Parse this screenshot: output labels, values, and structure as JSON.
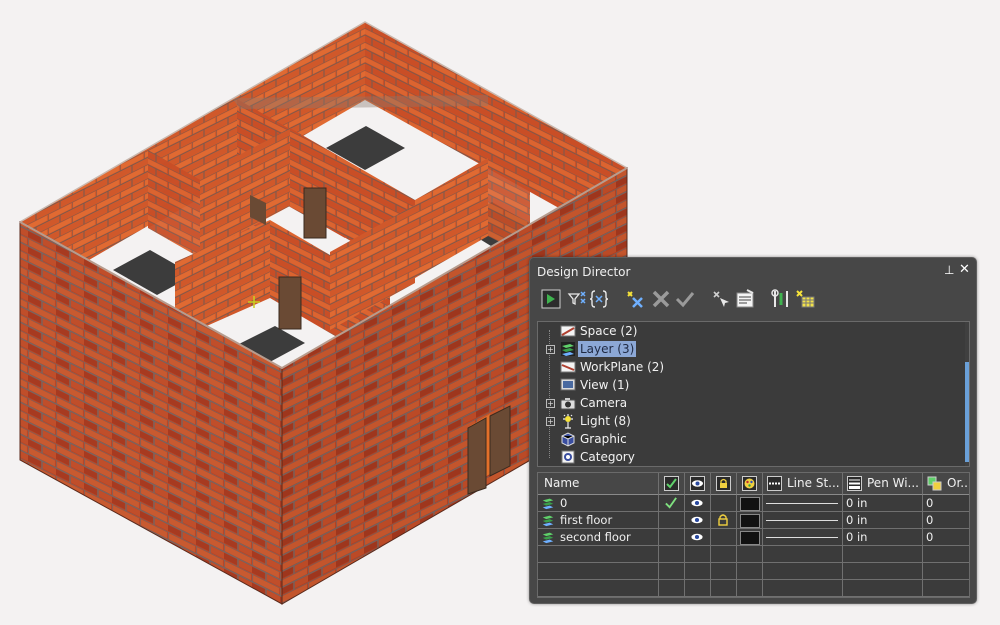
{
  "panel": {
    "title": "Design Director",
    "pin_glyph": "⊥",
    "close_glyph": "✕",
    "toolbar": [
      {
        "icon": "select-tool-icon"
      },
      {
        "icon": "filter-icon"
      },
      {
        "icon": "scope-braces-icon"
      },
      {
        "icon": "new-item-icon"
      },
      {
        "icon": "delete-icon"
      },
      {
        "icon": "activate-checkmark-icon"
      },
      {
        "icon": "select-objects-icon"
      },
      {
        "icon": "properties-icon"
      },
      {
        "icon": "tools-icon"
      },
      {
        "icon": "settings-grid-icon"
      }
    ]
  },
  "tree": {
    "items": [
      {
        "label": "Space (2)",
        "icon": "space-icon",
        "expandable": false,
        "selected": false
      },
      {
        "label": "Layer (3)",
        "icon": "layer-icon",
        "expandable": true,
        "selected": true
      },
      {
        "label": "WorkPlane (2)",
        "icon": "workplane-icon",
        "expandable": false,
        "selected": false
      },
      {
        "label": "View (1)",
        "icon": "view-icon",
        "expandable": false,
        "selected": false
      },
      {
        "label": "Camera",
        "icon": "camera-icon",
        "expandable": true,
        "selected": false
      },
      {
        "label": "Light (8)",
        "icon": "light-icon",
        "expandable": true,
        "selected": false
      },
      {
        "label": "Graphic",
        "icon": "graphic-icon",
        "expandable": false,
        "selected": false
      },
      {
        "label": "Category",
        "icon": "category-icon",
        "expandable": false,
        "selected": false
      }
    ]
  },
  "grid": {
    "columns": [
      {
        "label": "Name",
        "icon": ""
      },
      {
        "label": "",
        "icon": "active-check-icon"
      },
      {
        "label": "",
        "icon": "visibility-eye-icon"
      },
      {
        "label": "",
        "icon": "lock-icon"
      },
      {
        "label": "",
        "icon": "color-palette-icon"
      },
      {
        "label": "Line St...",
        "icon": "line-style-icon"
      },
      {
        "label": "Pen Wi...",
        "icon": "pen-width-icon"
      },
      {
        "label": "Or...",
        "icon": "order-icon"
      }
    ],
    "rows": [
      {
        "name": "0",
        "active": true,
        "visible": true,
        "locked": false,
        "pen_width": "0 in",
        "order": "0"
      },
      {
        "name": "first floor",
        "active": false,
        "visible": true,
        "locked": true,
        "pen_width": "0 in",
        "order": "0"
      },
      {
        "name": "second floor",
        "active": false,
        "visible": true,
        "locked": false,
        "pen_width": "0 in",
        "order": "0"
      }
    ],
    "empty_rows": 3
  },
  "colors": {
    "panel_bg": "#474747",
    "tree_bg": "#3b3b3b",
    "selection": "#8ca8d6",
    "brick": "#b0402a"
  }
}
